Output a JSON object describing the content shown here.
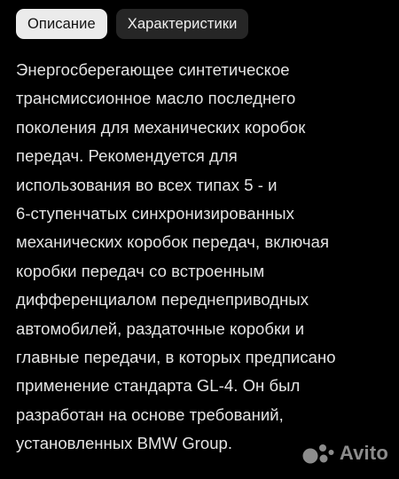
{
  "tabs": [
    {
      "label": "Описание",
      "active": true
    },
    {
      "label": "Характеристики",
      "active": false
    }
  ],
  "description_lines": [
    "Энергосберегающее синтетическое",
    "трансмиссионное масло последнего",
    "поколения для механических коробок",
    "передач. Рекомендуется для",
    "использования во всех типах 5 - и",
    "6-ступенчатых синхронизированных",
    "механических коробок передач, включая",
    "коробки передач со встроенным",
    "дифференциалом переднеприводных",
    "автомобилей, раздаточные коробки и",
    "главные передачи, в которых предписано",
    "применение стандарта GL-4. Он был",
    "разработан на основе требований,",
    "установленных BMW Group."
  ],
  "watermark": {
    "text": "Avito",
    "icon": "avito-logo-icon"
  },
  "colors": {
    "background": "#000000",
    "tab_active_bg": "#ebebeb",
    "tab_inactive_bg": "#262626",
    "text": "#e4e4e4"
  }
}
